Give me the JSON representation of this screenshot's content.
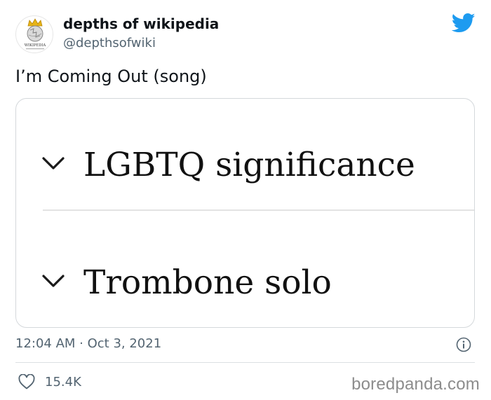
{
  "author": {
    "display_name": "depths of wikipedia",
    "handle": "@depthsofwiki",
    "avatar_icon": "wikipedia-globe-crown-icon",
    "avatar_text": "WIKIPEDIA"
  },
  "tweet": {
    "text": "I’m Coming Out (song)",
    "media": {
      "sections": [
        {
          "heading": "LGBTQ significance",
          "icon": "chevron-down-icon"
        },
        {
          "heading": "Trombone solo",
          "icon": "chevron-down-icon"
        }
      ]
    },
    "timestamp": "12:04 AM · Oct 3, 2021",
    "likes": "15.4K"
  },
  "icons": {
    "brand": "twitter-bird-icon",
    "info": "info-icon",
    "like": "heart-icon"
  },
  "colors": {
    "twitter_blue": "#1d9bf0",
    "secondary_text": "#536471",
    "primary_text": "#0f1419"
  },
  "watermark": "boredpanda.com"
}
